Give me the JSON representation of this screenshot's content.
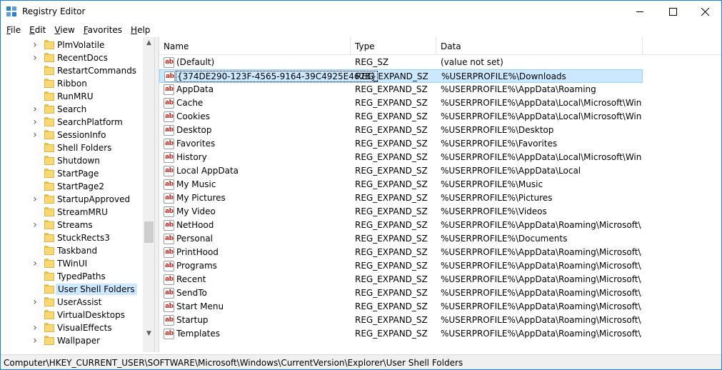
{
  "window": {
    "title": "Registry Editor"
  },
  "menu": [
    {
      "key": "F",
      "rest": "ile"
    },
    {
      "key": "E",
      "rest": "dit"
    },
    {
      "key": "V",
      "rest": "iew"
    },
    {
      "key": "F",
      "rest": "avorites",
      "prefix": ""
    },
    {
      "key": "H",
      "rest": "elp"
    }
  ],
  "tree": {
    "items": [
      {
        "label": "PlmVolatile",
        "expandable": true
      },
      {
        "label": "RecentDocs",
        "expandable": true
      },
      {
        "label": "RestartCommands",
        "expandable": false
      },
      {
        "label": "Ribbon",
        "expandable": false
      },
      {
        "label": "RunMRU",
        "expandable": false
      },
      {
        "label": "Search",
        "expandable": true
      },
      {
        "label": "SearchPlatform",
        "expandable": true
      },
      {
        "label": "SessionInfo",
        "expandable": true
      },
      {
        "label": "Shell Folders",
        "expandable": false
      },
      {
        "label": "Shutdown",
        "expandable": false
      },
      {
        "label": "StartPage",
        "expandable": false
      },
      {
        "label": "StartPage2",
        "expandable": false
      },
      {
        "label": "StartupApproved",
        "expandable": true
      },
      {
        "label": "StreamMRU",
        "expandable": false
      },
      {
        "label": "Streams",
        "expandable": true
      },
      {
        "label": "StuckRects3",
        "expandable": false
      },
      {
        "label": "Taskband",
        "expandable": false
      },
      {
        "label": "TWinUI",
        "expandable": true
      },
      {
        "label": "TypedPaths",
        "expandable": false
      },
      {
        "label": "User Shell Folders",
        "expandable": false,
        "selected": true
      },
      {
        "label": "UserAssist",
        "expandable": true
      },
      {
        "label": "VirtualDesktops",
        "expandable": false
      },
      {
        "label": "VisualEffects",
        "expandable": true
      },
      {
        "label": "Wallpaper",
        "expandable": true
      }
    ]
  },
  "list": {
    "columns": {
      "name": "Name",
      "type": "Type",
      "data": "Data"
    },
    "rows": [
      {
        "name": "(Default)",
        "type": "REG_SZ",
        "data": "(value not set)"
      },
      {
        "name": "{374DE290-123F-4565-9164-39C4925E467B}",
        "type": "REG_EXPAND_SZ",
        "data": "%USERPROFILE%\\Downloads",
        "selected": true
      },
      {
        "name": "AppData",
        "type": "REG_EXPAND_SZ",
        "data": "%USERPROFILE%\\AppData\\Roaming"
      },
      {
        "name": "Cache",
        "type": "REG_EXPAND_SZ",
        "data": "%USERPROFILE%\\AppData\\Local\\Microsoft\\Wind..."
      },
      {
        "name": "Cookies",
        "type": "REG_EXPAND_SZ",
        "data": "%USERPROFILE%\\AppData\\Local\\Microsoft\\Wind..."
      },
      {
        "name": "Desktop",
        "type": "REG_EXPAND_SZ",
        "data": "%USERPROFILE%\\Desktop"
      },
      {
        "name": "Favorites",
        "type": "REG_EXPAND_SZ",
        "data": "%USERPROFILE%\\Favorites"
      },
      {
        "name": "History",
        "type": "REG_EXPAND_SZ",
        "data": "%USERPROFILE%\\AppData\\Local\\Microsoft\\Wind..."
      },
      {
        "name": "Local AppData",
        "type": "REG_EXPAND_SZ",
        "data": "%USERPROFILE%\\AppData\\Local"
      },
      {
        "name": "My Music",
        "type": "REG_EXPAND_SZ",
        "data": "%USERPROFILE%\\Music"
      },
      {
        "name": "My Pictures",
        "type": "REG_EXPAND_SZ",
        "data": "%USERPROFILE%\\Pictures"
      },
      {
        "name": "My Video",
        "type": "REG_EXPAND_SZ",
        "data": "%USERPROFILE%\\Videos"
      },
      {
        "name": "NetHood",
        "type": "REG_EXPAND_SZ",
        "data": "%USERPROFILE%\\AppData\\Roaming\\Microsoft\\..."
      },
      {
        "name": "Personal",
        "type": "REG_EXPAND_SZ",
        "data": "%USERPROFILE%\\Documents"
      },
      {
        "name": "PrintHood",
        "type": "REG_EXPAND_SZ",
        "data": "%USERPROFILE%\\AppData\\Roaming\\Microsoft\\..."
      },
      {
        "name": "Programs",
        "type": "REG_EXPAND_SZ",
        "data": "%USERPROFILE%\\AppData\\Roaming\\Microsoft\\..."
      },
      {
        "name": "Recent",
        "type": "REG_EXPAND_SZ",
        "data": "%USERPROFILE%\\AppData\\Roaming\\Microsoft\\..."
      },
      {
        "name": "SendTo",
        "type": "REG_EXPAND_SZ",
        "data": "%USERPROFILE%\\AppData\\Roaming\\Microsoft\\..."
      },
      {
        "name": "Start Menu",
        "type": "REG_EXPAND_SZ",
        "data": "%USERPROFILE%\\AppData\\Roaming\\Microsoft\\..."
      },
      {
        "name": "Startup",
        "type": "REG_EXPAND_SZ",
        "data": "%USERPROFILE%\\AppData\\Roaming\\Microsoft\\..."
      },
      {
        "name": "Templates",
        "type": "REG_EXPAND_SZ",
        "data": "%USERPROFILE%\\AppData\\Roaming\\Microsoft\\..."
      }
    ],
    "value_icon_text": "ab"
  },
  "status": {
    "path": "Computer\\HKEY_CURRENT_USER\\SOFTWARE\\Microsoft\\Windows\\CurrentVersion\\Explorer\\User Shell Folders"
  },
  "icons": {
    "app": "registry-editor-icon",
    "minimize": "minimize-icon",
    "maximize": "maximize-icon",
    "close": "close-icon",
    "folder": "folder-icon",
    "chevron": "chevron-right-icon",
    "string_value": "string-value-icon"
  },
  "colors": {
    "accent": "#1883d7",
    "selection": "#cce8ff",
    "folder": "#f8d775"
  }
}
